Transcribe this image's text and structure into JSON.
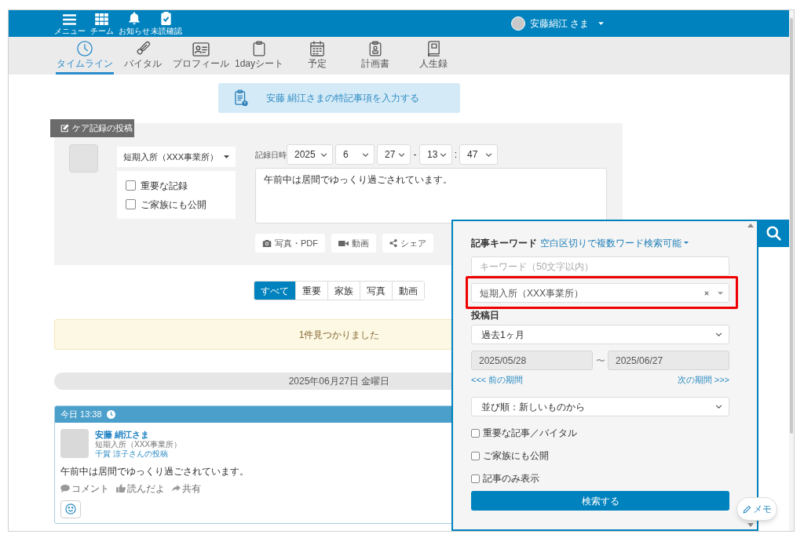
{
  "header": {
    "nav": [
      {
        "label": "メニュー"
      },
      {
        "label": "チーム"
      },
      {
        "label": "お知らせ"
      },
      {
        "label": "未読確認"
      }
    ],
    "user": {
      "name": "安藤絹江 さま"
    }
  },
  "tabs": [
    {
      "label": "タイムライン",
      "selected": true
    },
    {
      "label": "バイタル",
      "selected": false
    },
    {
      "label": "プロフィール",
      "selected": false
    },
    {
      "label": "1dayシート",
      "selected": false
    },
    {
      "label": "予定",
      "selected": false
    },
    {
      "label": "計画書",
      "selected": false
    },
    {
      "label": "人生録",
      "selected": false
    }
  ],
  "notice_banner": {
    "text": "安藤 絹江さまの特記事項を入力する"
  },
  "post_form": {
    "title": "ケア記録の投稿",
    "facility": "短期入所（XXX事業所）",
    "options": [
      {
        "label": "重要な記録",
        "checked": false
      },
      {
        "label": "ご家族にも公開",
        "checked": false
      }
    ],
    "datetime_label": "記録日時",
    "date_time": [
      {
        "kind": "select",
        "value": "2025"
      },
      {
        "kind": "select",
        "value": "6"
      },
      {
        "kind": "select",
        "value": "27"
      },
      {
        "kind": "separator",
        "value": "-"
      },
      {
        "kind": "select",
        "value": "13"
      },
      {
        "kind": "separator",
        "value": ":"
      },
      {
        "kind": "select",
        "value": "47"
      }
    ],
    "text": "午前中は居間でゆっくり過ごされています。",
    "attachments": [
      {
        "label": "写真・PDF"
      },
      {
        "label": "動画"
      },
      {
        "label": "シェア"
      }
    ]
  },
  "filters": [
    {
      "label": "すべて",
      "selected": true
    },
    {
      "label": "重要",
      "selected": false
    },
    {
      "label": "家族",
      "selected": false
    },
    {
      "label": "写真",
      "selected": false
    },
    {
      "label": "動画",
      "selected": false
    }
  ],
  "result_message": "1件見つかりました",
  "date_header": "2025年06月27日 金曜日",
  "posts": [
    {
      "time": "今日 13:38",
      "resident": "安藤 絹江さま",
      "facility": "短期入所（XXX事業所）",
      "author": "千賀 涼子さんの投稿",
      "text": "午前中は居間でゆっくり過ごされています。",
      "actions": [
        {
          "label": "コメント"
        },
        {
          "label": "読んだよ"
        },
        {
          "label": "共有"
        }
      ]
    }
  ],
  "search_panel": {
    "keyword_label": "記事キーワード",
    "keyword_hint": "空白区切りで複数ワード検索可能",
    "keyword_placeholder": "キーワード（50文字以内）",
    "facility": {
      "value": "短期入所（XXX事業所）",
      "highlighted": true
    },
    "date_label": "投稿日",
    "period": "過去1ヶ月",
    "date_from": "2025/05/28",
    "date_separator": "〜",
    "date_to": "2025/06/27",
    "prev_link": "<<< 前の期間",
    "next_link": "次の期間 >>>",
    "sort": "並び順：新しいものから",
    "options": [
      {
        "label": "重要な記事／バイタル",
        "checked": false
      },
      {
        "label": "ご家族にも公開",
        "checked": false
      },
      {
        "label": "記事のみ表示",
        "checked": false
      }
    ],
    "submit": "検索する"
  },
  "memo_button": {
    "label": "メモ"
  }
}
